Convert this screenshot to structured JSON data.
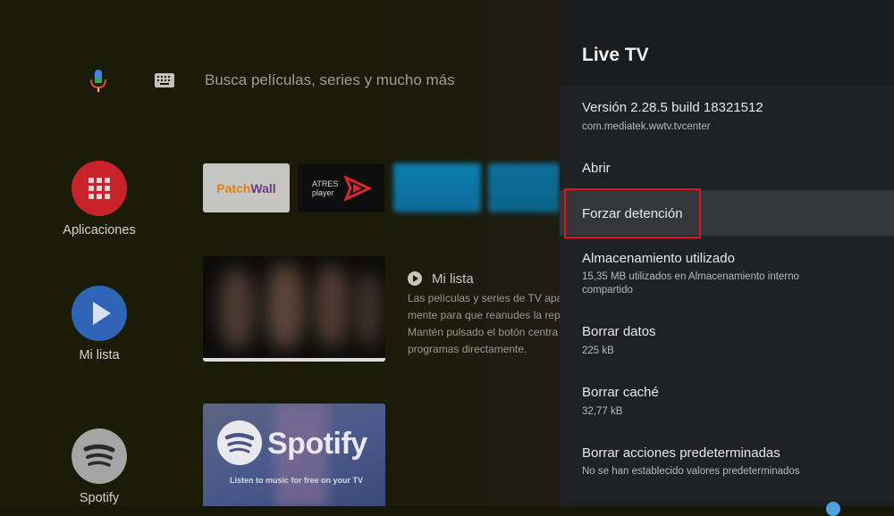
{
  "search": {
    "placeholder": "Busca películas, series y mucho más"
  },
  "sidebar": {
    "items": [
      {
        "label": "Aplicaciones",
        "icon": "apps-grid-icon",
        "color": "#c8222b"
      },
      {
        "label": "Mi lista",
        "icon": "play-icon",
        "color": "#2f64b7"
      },
      {
        "label": "Spotify",
        "icon": "spotify-icon",
        "color": "#a5a5a5"
      }
    ]
  },
  "apps_row": {
    "patchwall": {
      "part1": "Patch",
      "part2": "Wall"
    },
    "atres": {
      "line1": "ATRES",
      "line2": "player"
    }
  },
  "mi_lista": {
    "title": "Mi lista",
    "description": [
      "Las películas y series de TV apa",
      "mente para que reanudes la rep",
      "Mantén pulsado el botón centra",
      "programas directamente."
    ]
  },
  "spotify_tile": {
    "word": "Spotify",
    "tagline": "Listen to music for free on your TV"
  },
  "panel": {
    "title": "Live TV",
    "version": "Versión 2.28.5 build 18321512",
    "package": "com.mediatek.wwtv.tvcenter",
    "open": "Abrir",
    "force_stop": "Forzar detención",
    "storage_title": "Almacenamiento utilizado",
    "storage_sub_1": "15,35 MB utilizados en Almacenamiento interno",
    "storage_sub_2": "compartido",
    "clear_data": "Borrar datos",
    "clear_data_sub": "225 kB",
    "clear_cache": "Borrar caché",
    "clear_cache_sub": "32,77 kB",
    "clear_defaults": "Borrar acciones predeterminadas",
    "clear_defaults_sub": "No se han establecido valores predeterminados"
  },
  "colors": {
    "highlight": "#e4121d",
    "panel_bg": "#202124"
  }
}
